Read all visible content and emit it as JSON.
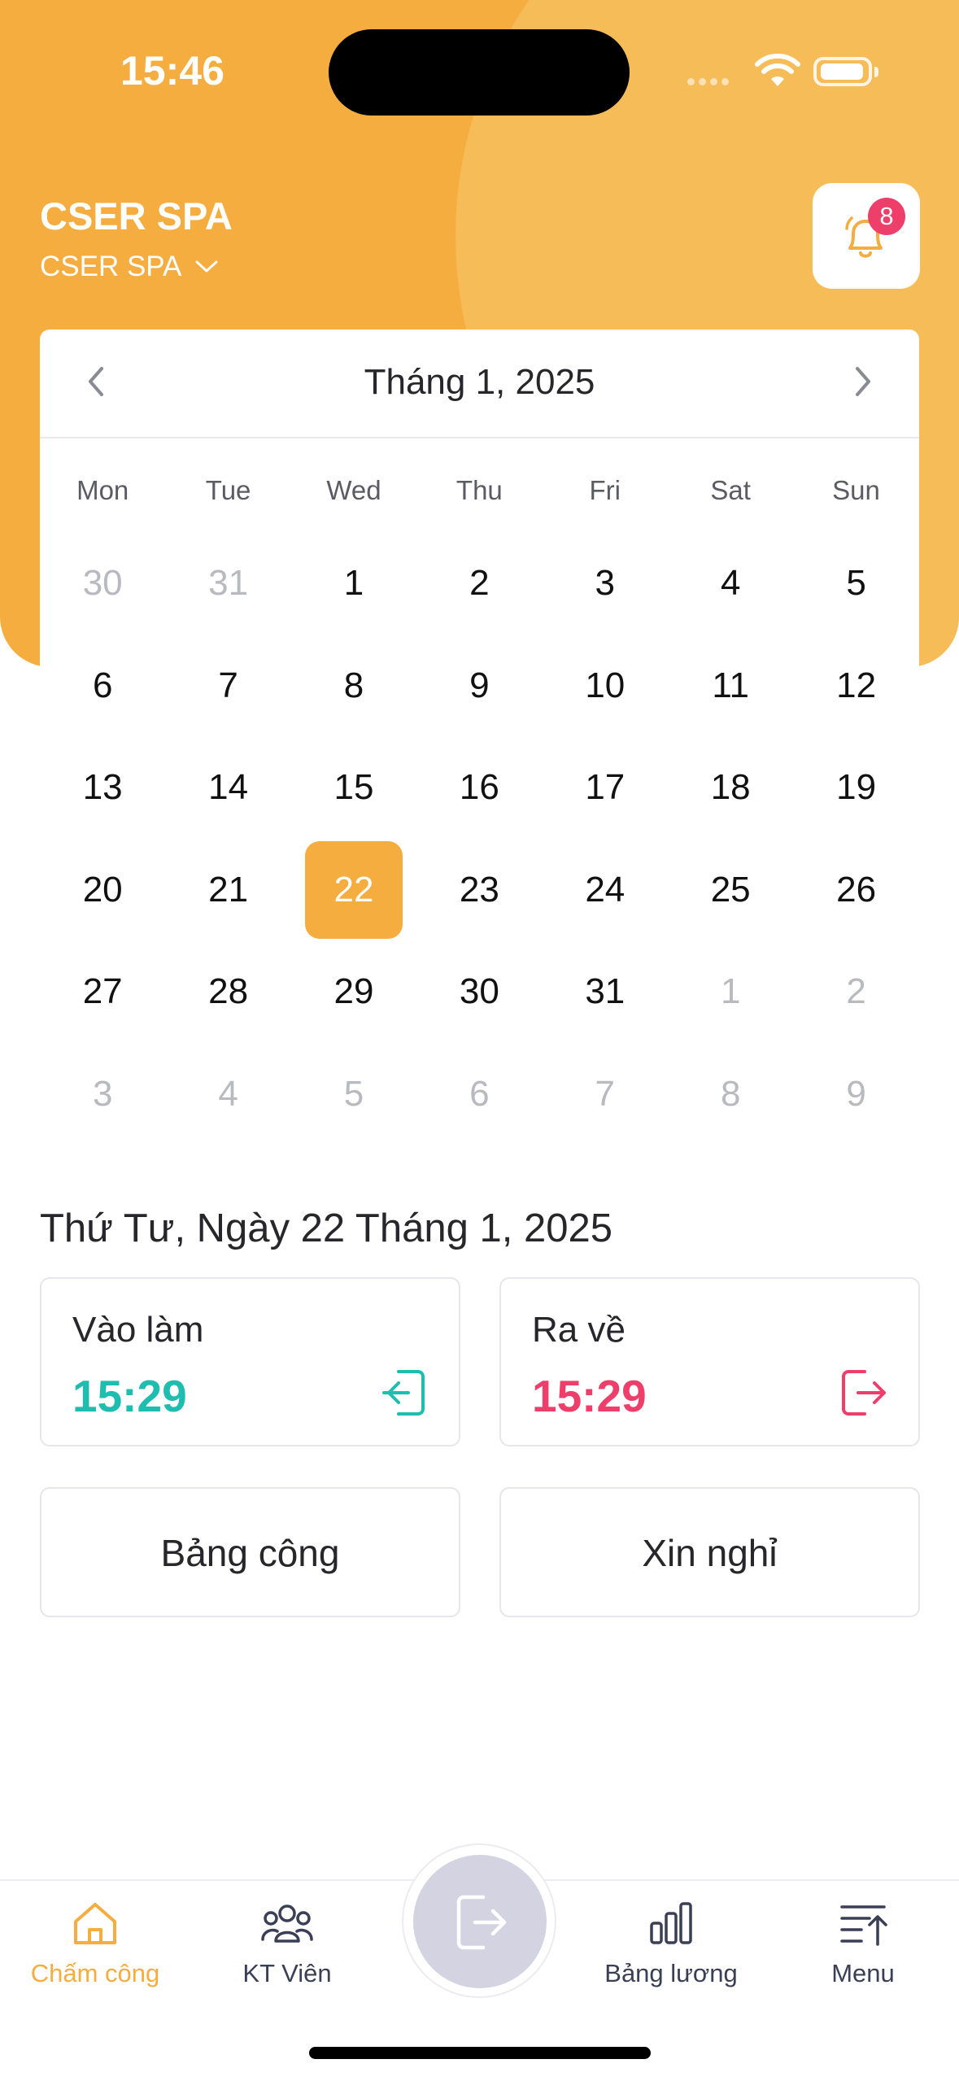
{
  "status_bar": {
    "time": "15:46"
  },
  "header": {
    "company_name": "CSER SPA",
    "branch_selector": "CSER SPA",
    "notification_count": "8"
  },
  "calendar": {
    "month_title": "Tháng 1, 2025",
    "weekdays": [
      "Mon",
      "Tue",
      "Wed",
      "Thu",
      "Fri",
      "Sat",
      "Sun"
    ],
    "weeks": [
      [
        "30",
        "31",
        "1",
        "2",
        "3",
        "4",
        "5"
      ],
      [
        "6",
        "7",
        "8",
        "9",
        "10",
        "11",
        "12"
      ],
      [
        "13",
        "14",
        "15",
        "16",
        "17",
        "18",
        "19"
      ],
      [
        "20",
        "21",
        "22",
        "23",
        "24",
        "25",
        "26"
      ],
      [
        "27",
        "28",
        "29",
        "30",
        "31",
        "1",
        "2"
      ],
      [
        "3",
        "4",
        "5",
        "6",
        "7",
        "8",
        "9"
      ]
    ],
    "selected_day": "22"
  },
  "selected_date_label": "Thứ Tư, Ngày 22 Tháng 1, 2025",
  "check_in": {
    "label": "Vào làm",
    "time": "15:29",
    "color": "#1fbcb0"
  },
  "check_out": {
    "label": "Ra về",
    "time": "15:29",
    "color": "#ee3f6b"
  },
  "buttons": {
    "timesheet": "Bảng công",
    "leave_request": "Xin nghỉ"
  },
  "tabbar": {
    "items": [
      {
        "label": "Chấm công",
        "icon": "home-icon"
      },
      {
        "label": "KT Viên",
        "icon": "users-icon"
      },
      {
        "label": "Bảng lương",
        "icon": "bar-chart-icon"
      },
      {
        "label": "Menu",
        "icon": "menu-icon"
      }
    ],
    "center_action_icon": "logout-icon"
  },
  "colors": {
    "accent": "#f4ad3e",
    "muted_day": "#b9b9c0"
  }
}
